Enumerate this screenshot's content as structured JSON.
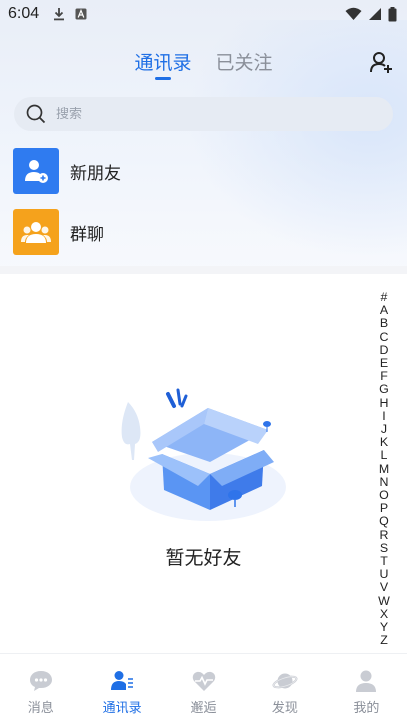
{
  "status_bar": {
    "time": "6:04"
  },
  "header": {
    "tabs": [
      {
        "label": "通讯录",
        "active": true
      },
      {
        "label": "已关注",
        "active": false
      }
    ]
  },
  "search": {
    "placeholder": "搜索"
  },
  "entries": [
    {
      "label": "新朋友",
      "icon": "new-friend-icon",
      "color": "#2f7bf0"
    },
    {
      "label": "群聊",
      "icon": "group-chat-icon",
      "color": "#f5a21c"
    }
  ],
  "empty_state": {
    "text": "暂无好友"
  },
  "alpha_index": [
    "#",
    "A",
    "B",
    "C",
    "D",
    "E",
    "F",
    "G",
    "H",
    "I",
    "J",
    "K",
    "L",
    "M",
    "N",
    "O",
    "P",
    "Q",
    "R",
    "S",
    "T",
    "U",
    "V",
    "W",
    "X",
    "Y",
    "Z"
  ],
  "bottom_nav": [
    {
      "label": "消息",
      "icon": "chat-bubble-icon",
      "active": false
    },
    {
      "label": "通讯录",
      "icon": "contacts-icon",
      "active": true
    },
    {
      "label": "邂逅",
      "icon": "heart-pulse-icon",
      "active": false
    },
    {
      "label": "发现",
      "icon": "planet-icon",
      "active": false
    },
    {
      "label": "我的",
      "icon": "profile-icon",
      "active": false
    }
  ],
  "colors": {
    "accent": "#1f6fe5",
    "inactive": "#8a8f99"
  }
}
